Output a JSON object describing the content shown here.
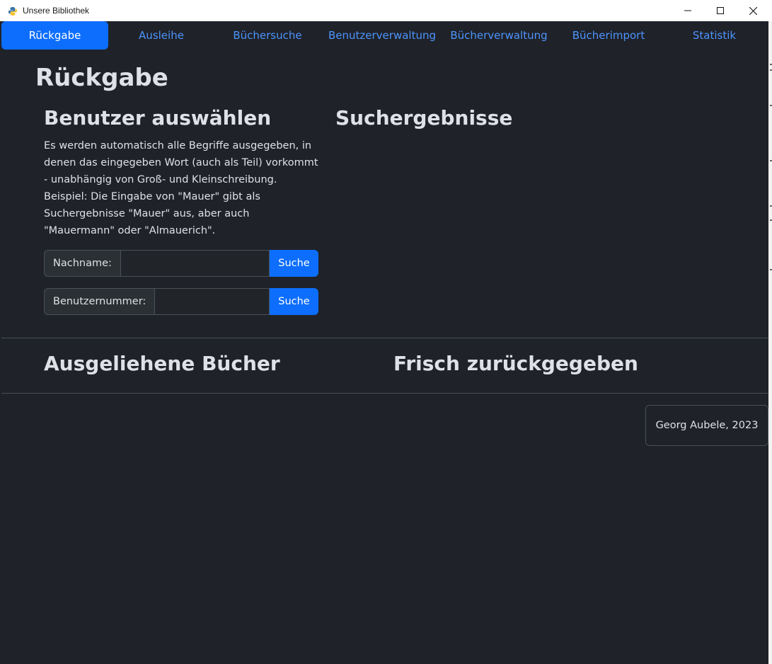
{
  "window": {
    "title": "Unsere Bibliothek"
  },
  "nav": {
    "items": [
      {
        "label": "Rückgabe",
        "active": true
      },
      {
        "label": "Ausleihe",
        "active": false
      },
      {
        "label": "Büchersuche",
        "active": false
      },
      {
        "label": "Benutzerverwaltung",
        "active": false
      },
      {
        "label": "Bücherverwaltung",
        "active": false
      },
      {
        "label": "Bücherimport",
        "active": false
      },
      {
        "label": "Statistik",
        "active": false
      }
    ]
  },
  "page": {
    "title": "Rückgabe"
  },
  "user_select": {
    "heading": "Benutzer auswählen",
    "description_1": "Es werden automatisch alle Begriffe ausgegeben, in denen das eingegeben Wort (auch als Teil) vorkommt - unabhängig von Groß- und Kleinschreibung.",
    "description_2": "Beispiel: Die Eingabe von \"Mauer\" gibt als Suchergebnisse \"Mauer\" aus, aber auch \"Mauermann\" oder \"Almauerich\".",
    "lastname_label": "Nachname:",
    "lastname_value": "",
    "lastname_button": "Suche",
    "usernumber_label": "Benutzernummer:",
    "usernumber_value": "",
    "usernumber_button": "Suche"
  },
  "results": {
    "heading": "Suchergebnisse"
  },
  "borrowed": {
    "heading": "Ausgeliehene Bücher"
  },
  "returned": {
    "heading": "Frisch zurückgegeben"
  },
  "footer": {
    "text": "Georg Aubele, 2023"
  },
  "colors": {
    "accent": "#0d6efd",
    "link": "#4d94ff",
    "background": "#1f2228",
    "text": "#dee2e6"
  }
}
